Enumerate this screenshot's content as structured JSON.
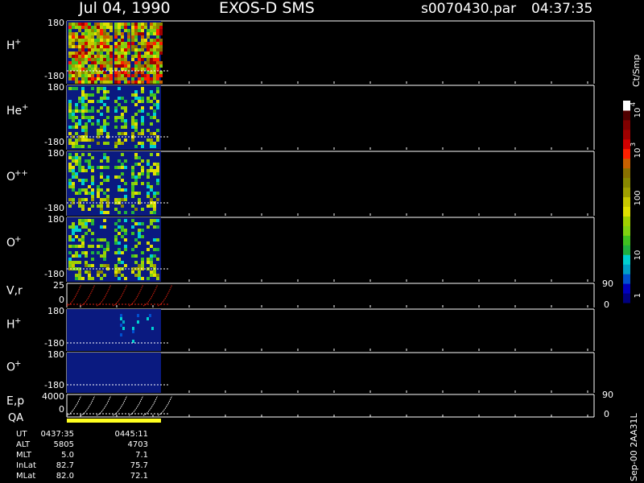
{
  "header": {
    "date": "Jul 04, 1990",
    "instrument": "EXOS-D SMS",
    "file": "s0070430.par",
    "time": "04:37:35"
  },
  "panels": [
    {
      "label": "H",
      "sup": "+",
      "y_top": "180",
      "y_bot": "-180"
    },
    {
      "label": "He",
      "sup": "+",
      "y_top": "180",
      "y_bot": "-180"
    },
    {
      "label": "O",
      "sup": "++",
      "y_top": "180",
      "y_bot": "-180"
    },
    {
      "label": "O",
      "sup": "+",
      "y_top": "180",
      "y_bot": "-180"
    },
    {
      "label": "V,r",
      "sup": "",
      "y_top": "25",
      "y_bot": "0",
      "right_top": "90",
      "right_bot": "0"
    },
    {
      "label": "H",
      "sup": "+",
      "y_top": "180",
      "y_bot": "-180"
    },
    {
      "label": "O",
      "sup": "+",
      "y_top": "180",
      "y_bot": "-180"
    },
    {
      "label": "E,p",
      "sup": "",
      "y_top": "4000",
      "y_bot": "0",
      "right_top": "90",
      "right_bot": "0"
    }
  ],
  "qa_label": "QA",
  "colorbar": {
    "title": "Ct/Smp",
    "ticks": [
      "1",
      "10",
      "100",
      "10",
      "10"
    ],
    "tick_sups": [
      "",
      "",
      "",
      "3",
      "4"
    ],
    "colors": [
      "#000080",
      "#0000c0",
      "#0050d0",
      "#00a0c8",
      "#00d0d0",
      "#20b040",
      "#40c020",
      "#80d010",
      "#a0d000",
      "#e0e000",
      "#c8c800",
      "#a0a000",
      "#888800",
      "#887000",
      "#c86000",
      "#ff2000",
      "#d00000",
      "#a00000",
      "#800000",
      "#500000",
      "#ffffff"
    ]
  },
  "footer": {
    "rows": [
      {
        "label": "UT",
        "v1": "0437:35",
        "v2": "0445:11"
      },
      {
        "label": "ALT",
        "v1": "5805",
        "v2": "4703"
      },
      {
        "label": "MLT",
        "v1": "5.0",
        "v2": "7.1"
      },
      {
        "label": "InLat",
        "v1": "82.7",
        "v2": "75.7"
      },
      {
        "label": "MLat",
        "v1": "82.0",
        "v2": "72.1"
      }
    ],
    "version": "Sep-00 2AA31L"
  },
  "chart_data": {
    "type": "heatmap",
    "title": "Jul 04, 1990   EXOS-D SMS",
    "x_range_ut": [
      "0437:35",
      "0445:11"
    ],
    "panels": [
      "H+",
      "He+",
      "O++",
      "O+",
      "V,r",
      "H+",
      "O+",
      "E,p"
    ],
    "colorbar_unit": "Ct/Smp",
    "colorbar_scale": "log",
    "colorbar_range": [
      1,
      10000
    ]
  }
}
